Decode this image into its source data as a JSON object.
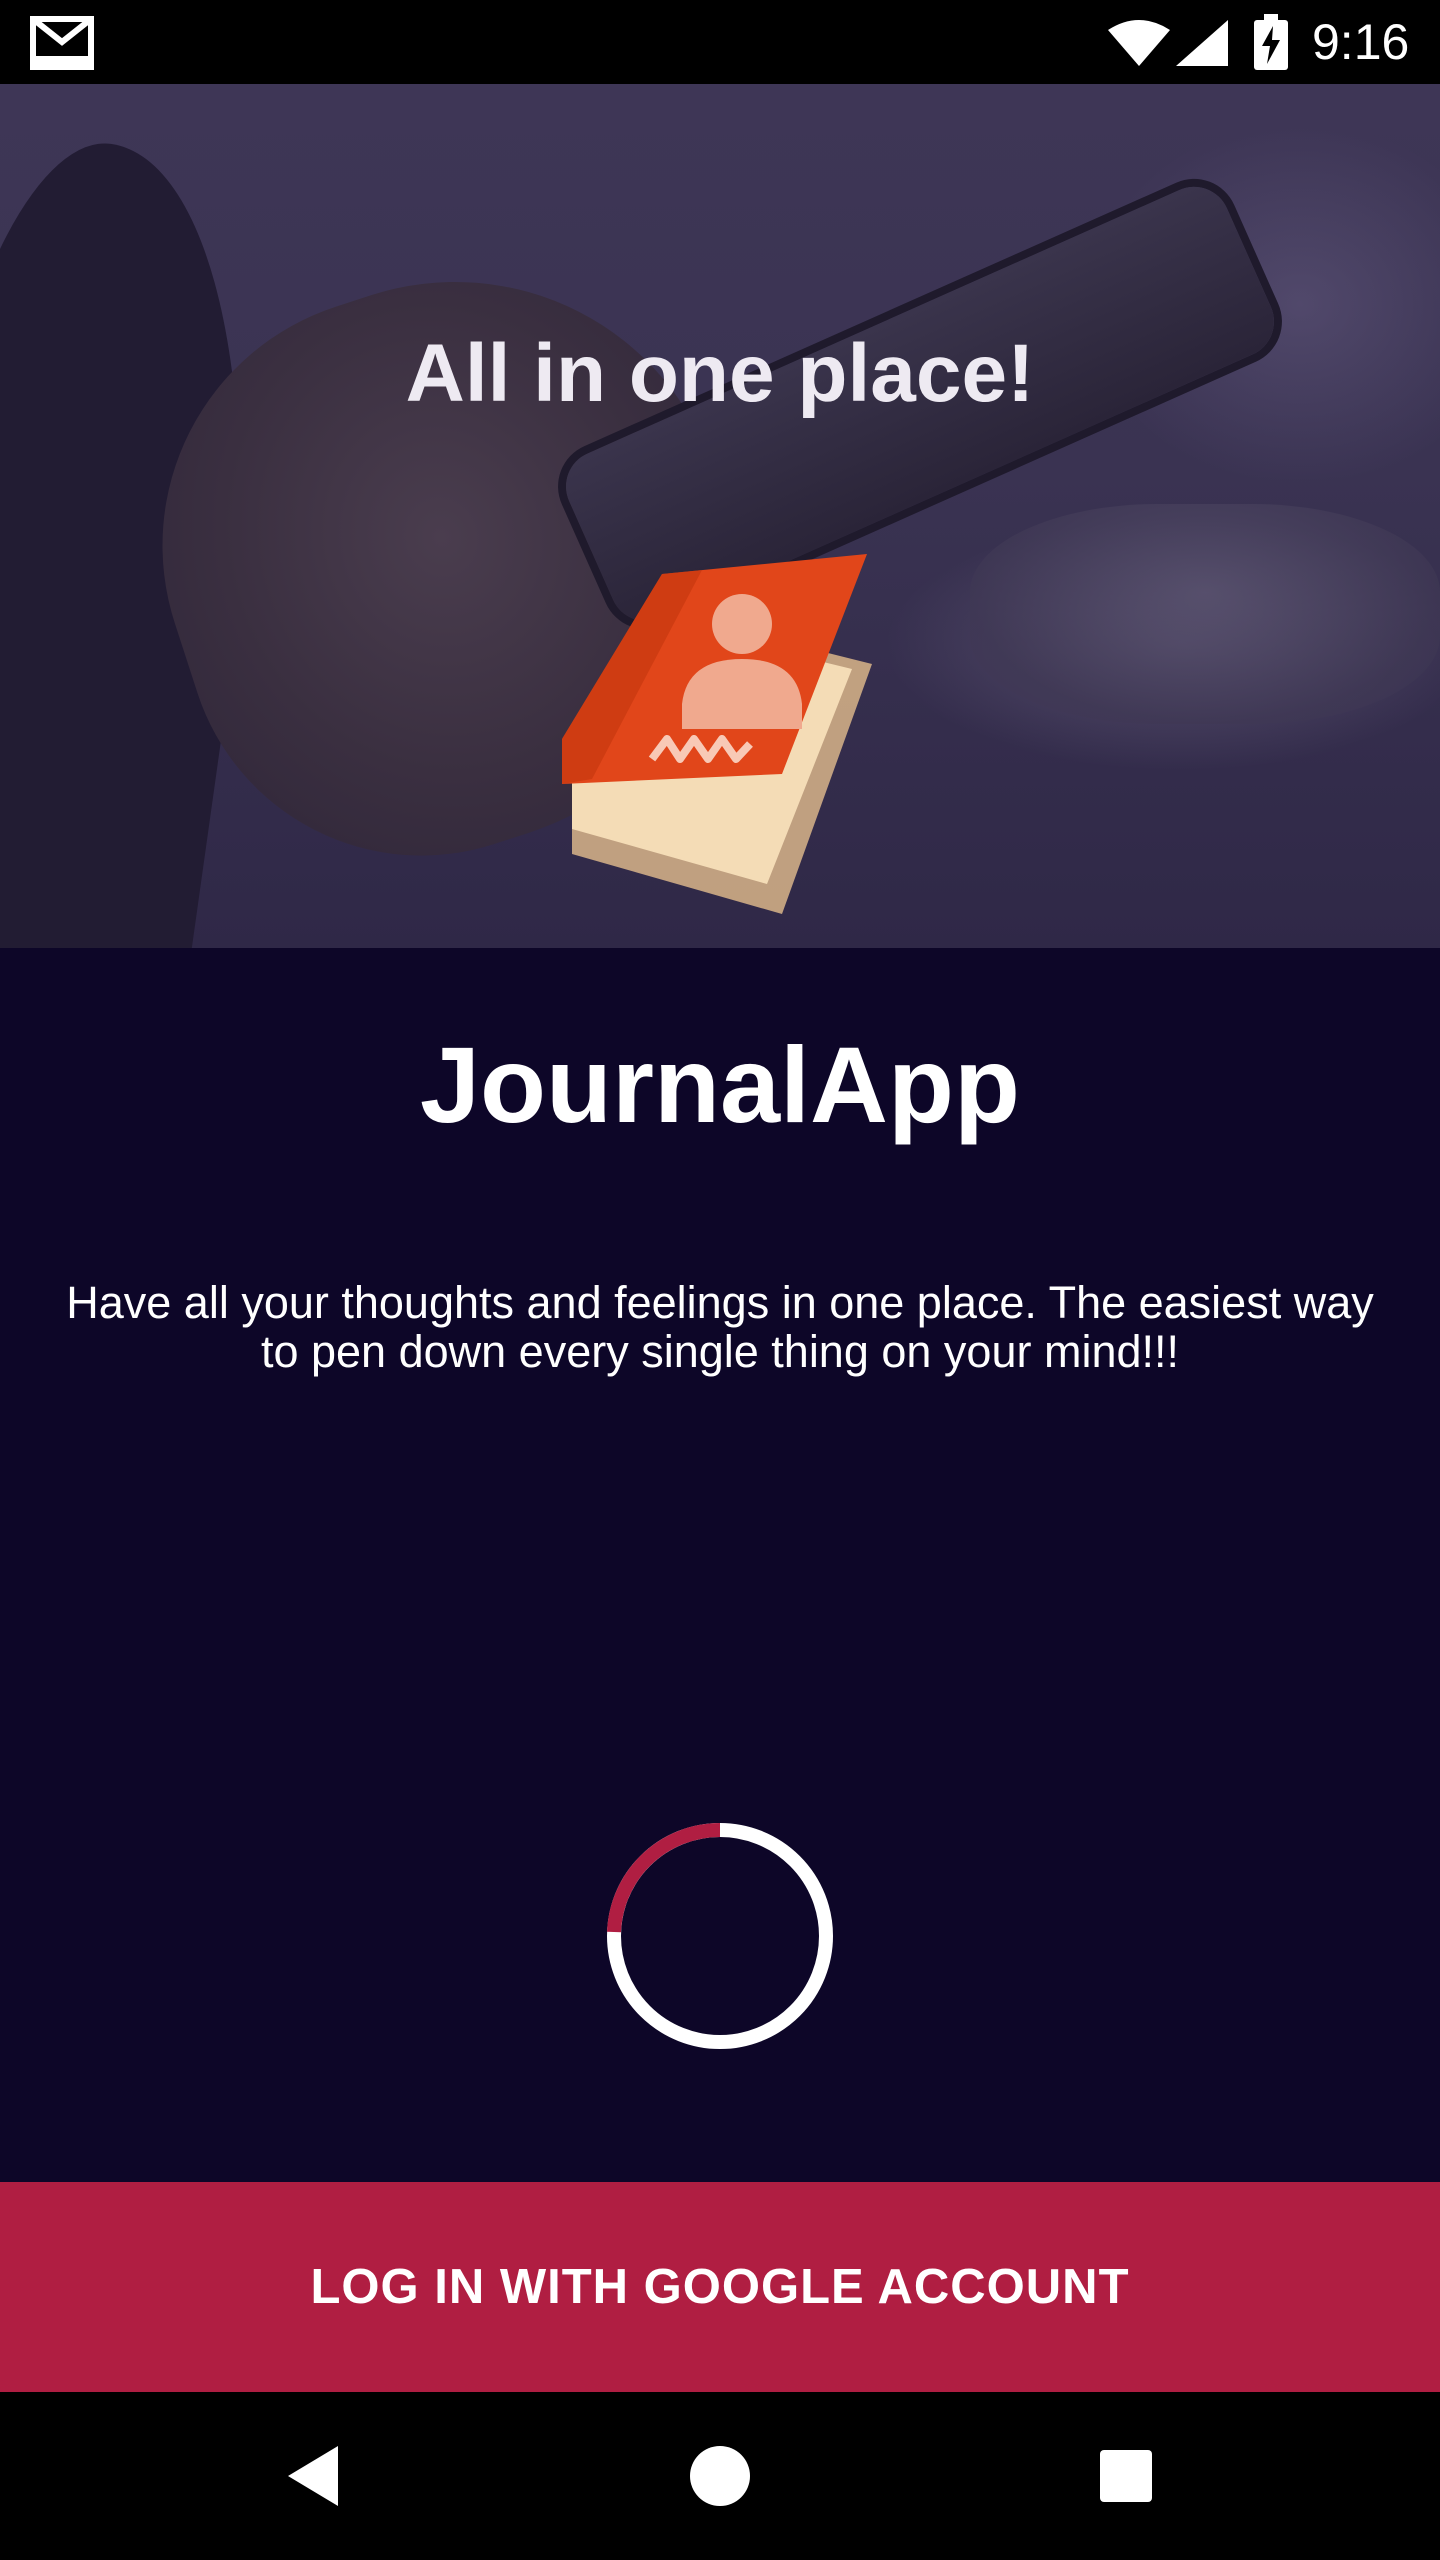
{
  "status_bar": {
    "time": "9:16",
    "icons": [
      "gmail-icon",
      "wifi-icon",
      "signal-icon",
      "battery-charging-icon"
    ]
  },
  "hero": {
    "title": "All in one place!",
    "logo_icon": "journal-book-icon"
  },
  "app": {
    "name": "JournalApp",
    "description": "Have all your thoughts and feelings in one place. The easiest way to pen down every single thing on your mind!!!"
  },
  "login_button": {
    "label": "LOG IN WITH GOOGLE ACCOUNT"
  },
  "navigation": {
    "icons": [
      "back-icon",
      "home-icon",
      "recents-icon"
    ]
  },
  "colors": {
    "background": "#0d0628",
    "accent": "#b01e42",
    "spinner_track": "#ffffff",
    "logo_orange": "#e04a1c",
    "logo_pages": "#f2d6b0"
  }
}
